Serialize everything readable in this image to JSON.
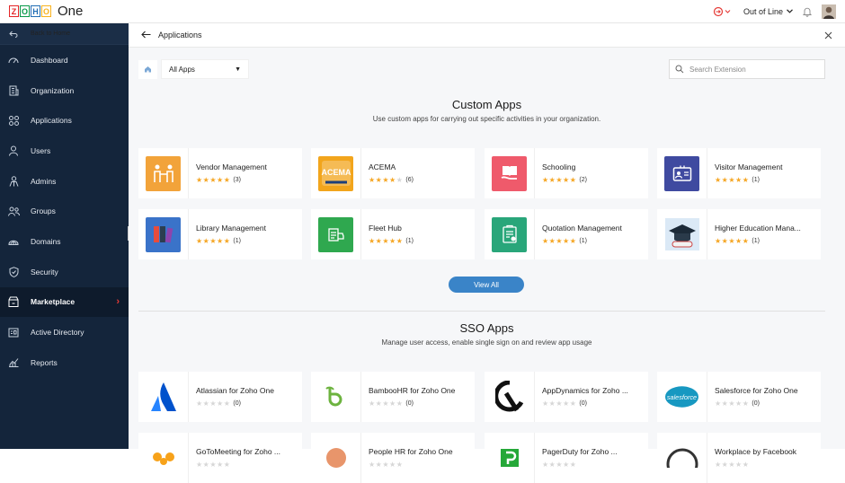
{
  "topbar": {
    "logo_letters": [
      "Z",
      "O",
      "H",
      "O"
    ],
    "logo_text": "One",
    "status": "Out of Line"
  },
  "sidebar": {
    "back_label": "Back to Home",
    "items": [
      {
        "label": "Dashboard",
        "icon": "gauge-icon"
      },
      {
        "label": "Organization",
        "icon": "building-icon"
      },
      {
        "label": "Applications",
        "icon": "apps-grid-icon"
      },
      {
        "label": "Users",
        "icon": "user-icon"
      },
      {
        "label": "Admins",
        "icon": "admin-icon"
      },
      {
        "label": "Groups",
        "icon": "group-icon"
      },
      {
        "label": "Domains",
        "icon": "domain-icon"
      },
      {
        "label": "Security",
        "icon": "shield-icon"
      },
      {
        "label": "Marketplace",
        "icon": "marketplace-icon",
        "active": true
      },
      {
        "label": "Active Directory",
        "icon": "directory-icon"
      },
      {
        "label": "Reports",
        "icon": "reports-icon"
      }
    ]
  },
  "header": {
    "title": "Applications"
  },
  "filter": {
    "selected": "All Apps",
    "search_placeholder": "Search Extension"
  },
  "custom": {
    "title": "Custom Apps",
    "subtitle": "Use custom apps for carrying out specific activities in your organization.",
    "apps": [
      {
        "name": "Vendor Management",
        "stars": 5,
        "count": "(3)",
        "color": "#f2a33a"
      },
      {
        "name": "ACEMA",
        "stars": 4,
        "count": "(6)",
        "color": "#f2a51c"
      },
      {
        "name": "Schooling",
        "stars": 5,
        "count": "(2)",
        "color": "#ef5a6b"
      },
      {
        "name": "Visitor Management",
        "stars": 5,
        "count": "(1)",
        "color": "#3f4aa0"
      },
      {
        "name": "Library Management",
        "stars": 5,
        "count": "(1)",
        "color": "#3a73c9"
      },
      {
        "name": "Fleet Hub",
        "stars": 5,
        "count": "(1)",
        "color": "#2fa84f"
      },
      {
        "name": "Quotation Management",
        "stars": 5,
        "count": "(1)",
        "color": "#29a67a"
      },
      {
        "name": "Higher Education Mana...",
        "stars": 5,
        "count": "(1)",
        "color": "#5a9bd6"
      }
    ],
    "view_all": "View All"
  },
  "sso": {
    "title": "SSO Apps",
    "subtitle": "Manage user access, enable single sign on and review app usage",
    "apps": [
      {
        "name": "Atlassian for Zoho One",
        "stars": 0,
        "count": "(0)",
        "color": "#1f6fe0"
      },
      {
        "name": "BambooHR for Zoho One",
        "stars": 0,
        "count": "(0)",
        "color": "#6db33f"
      },
      {
        "name": "AppDynamics for Zoho ...",
        "stars": 0,
        "count": "(0)",
        "color": "#111111"
      },
      {
        "name": "Salesforce for Zoho One",
        "stars": 0,
        "count": "(0)",
        "color": "#1798c1"
      },
      {
        "name": "GoToMeeting for Zoho ...",
        "stars": 0,
        "count": "",
        "color": "#f7a21a"
      },
      {
        "name": "People HR for Zoho One",
        "stars": 0,
        "count": "",
        "color": "#e8956b"
      },
      {
        "name": "PagerDuty for Zoho ...",
        "stars": 0,
        "count": "",
        "color": "#25a838"
      },
      {
        "name": "Workplace by Facebook",
        "stars": 0,
        "count": "",
        "color": "#333333"
      }
    ]
  }
}
